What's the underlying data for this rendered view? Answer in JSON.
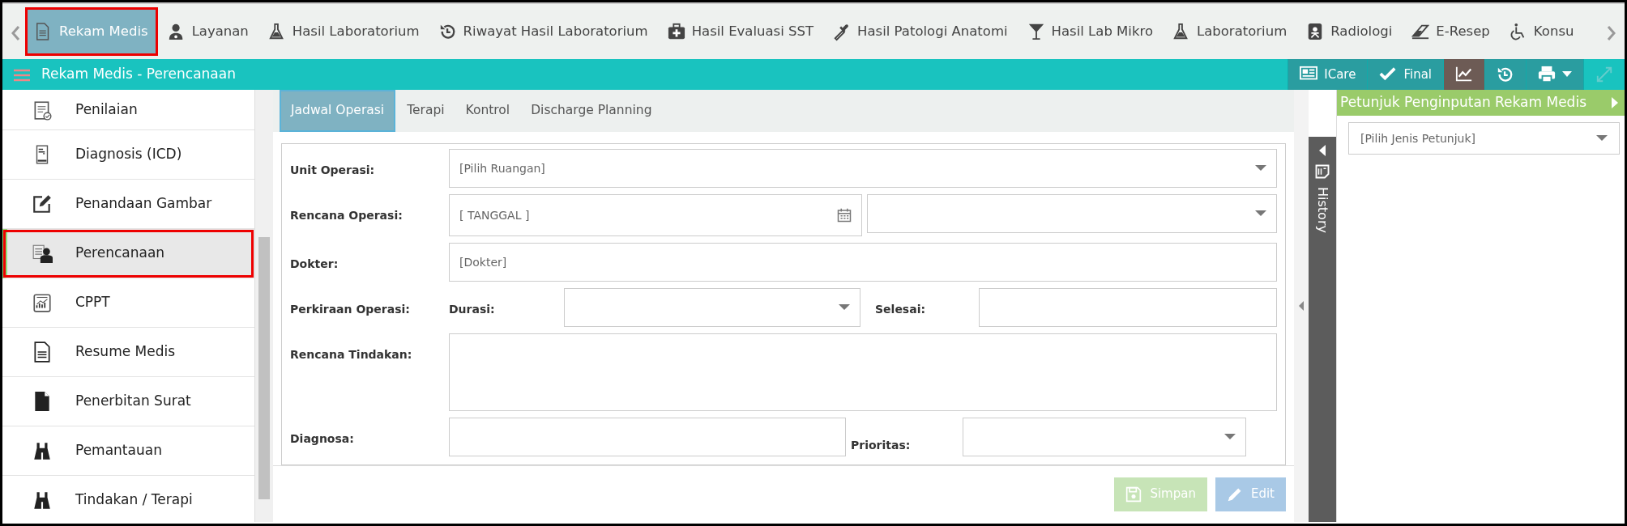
{
  "top_nav": {
    "items": [
      {
        "label": "Rekam Medis",
        "selected": true,
        "highlighted": true
      },
      {
        "label": "Layanan",
        "selected": false,
        "highlighted": false
      },
      {
        "label": "Hasil Laboratorium",
        "selected": false,
        "highlighted": false
      },
      {
        "label": "Riwayat Hasil Laboratorium",
        "selected": false,
        "highlighted": false
      },
      {
        "label": "Hasil Evaluasi SST",
        "selected": false,
        "highlighted": false
      },
      {
        "label": "Hasil Patologi Anatomi",
        "selected": false,
        "highlighted": false
      },
      {
        "label": "Hasil Lab Mikro",
        "selected": false,
        "highlighted": false
      },
      {
        "label": "Laboratorium",
        "selected": false,
        "highlighted": false
      },
      {
        "label": "Radiologi",
        "selected": false,
        "highlighted": false
      },
      {
        "label": "E-Resep",
        "selected": false,
        "highlighted": false
      },
      {
        "label": "Konsu",
        "selected": false,
        "highlighted": false
      }
    ]
  },
  "header": {
    "title": "Rekam Medis - Perencanaan",
    "buttons": [
      {
        "kind": "icare",
        "label": "ICare",
        "active": false,
        "disabled": false
      },
      {
        "kind": "final",
        "label": "Final",
        "active": false,
        "disabled": false
      },
      {
        "kind": "chart",
        "active": true,
        "disabled": false
      },
      {
        "kind": "history",
        "active": false,
        "disabled": false
      },
      {
        "kind": "print",
        "active": false,
        "disabled": false
      },
      {
        "kind": "expand",
        "active": false,
        "disabled": true
      }
    ]
  },
  "sidebar": {
    "items": [
      {
        "label": "Penilaian",
        "selected": false,
        "highlighted": false
      },
      {
        "label": "Diagnosis (ICD)",
        "selected": false,
        "highlighted": false
      },
      {
        "label": "Penandaan Gambar",
        "selected": false,
        "highlighted": false
      },
      {
        "label": "Perencanaan",
        "selected": true,
        "highlighted": true
      },
      {
        "label": "CPPT",
        "selected": false,
        "highlighted": false
      },
      {
        "label": "Resume Medis",
        "selected": false,
        "highlighted": false
      },
      {
        "label": "Penerbitan Surat",
        "selected": false,
        "highlighted": false
      },
      {
        "label": "Pemantauan",
        "selected": false,
        "highlighted": false
      },
      {
        "label": "Tindakan / Terapi",
        "selected": false,
        "highlighted": false
      }
    ]
  },
  "tabs": [
    {
      "label": "Jadwal Operasi",
      "selected": true
    },
    {
      "label": "Terapi",
      "selected": false
    },
    {
      "label": "Kontrol",
      "selected": false
    },
    {
      "label": "Discharge Planning",
      "selected": false
    }
  ],
  "form": {
    "unit_operasi": {
      "label": "Unit Operasi:",
      "placeholder": "[Pilih Ruangan]"
    },
    "rencana_operasi": {
      "label": "Rencana Operasi:",
      "date_placeholder": "[ TANGGAL  ]"
    },
    "dokter": {
      "label": "Dokter:",
      "placeholder": "[Dokter]"
    },
    "perkiraan_operasi": {
      "label": "Perkiraan Operasi:",
      "durasi_label": "Durasi:",
      "selesai_label": "Selesai:"
    },
    "rencana_tindakan": {
      "label": "Rencana Tindakan:"
    },
    "diagnosa": {
      "label": "Diagnosa:"
    },
    "prioritas": {
      "label": "Prioritas:"
    }
  },
  "actions": [
    {
      "kind": "save",
      "label": "Simpan",
      "disabled": true
    },
    {
      "kind": "edit",
      "label": "Edit",
      "disabled": true
    }
  ],
  "history_panel": {
    "label": "History"
  },
  "guide_panel": {
    "title": "Petunjuk Penginputan Rekam Medis",
    "placeholder": "[Pilih Jenis Petunjuk]"
  }
}
